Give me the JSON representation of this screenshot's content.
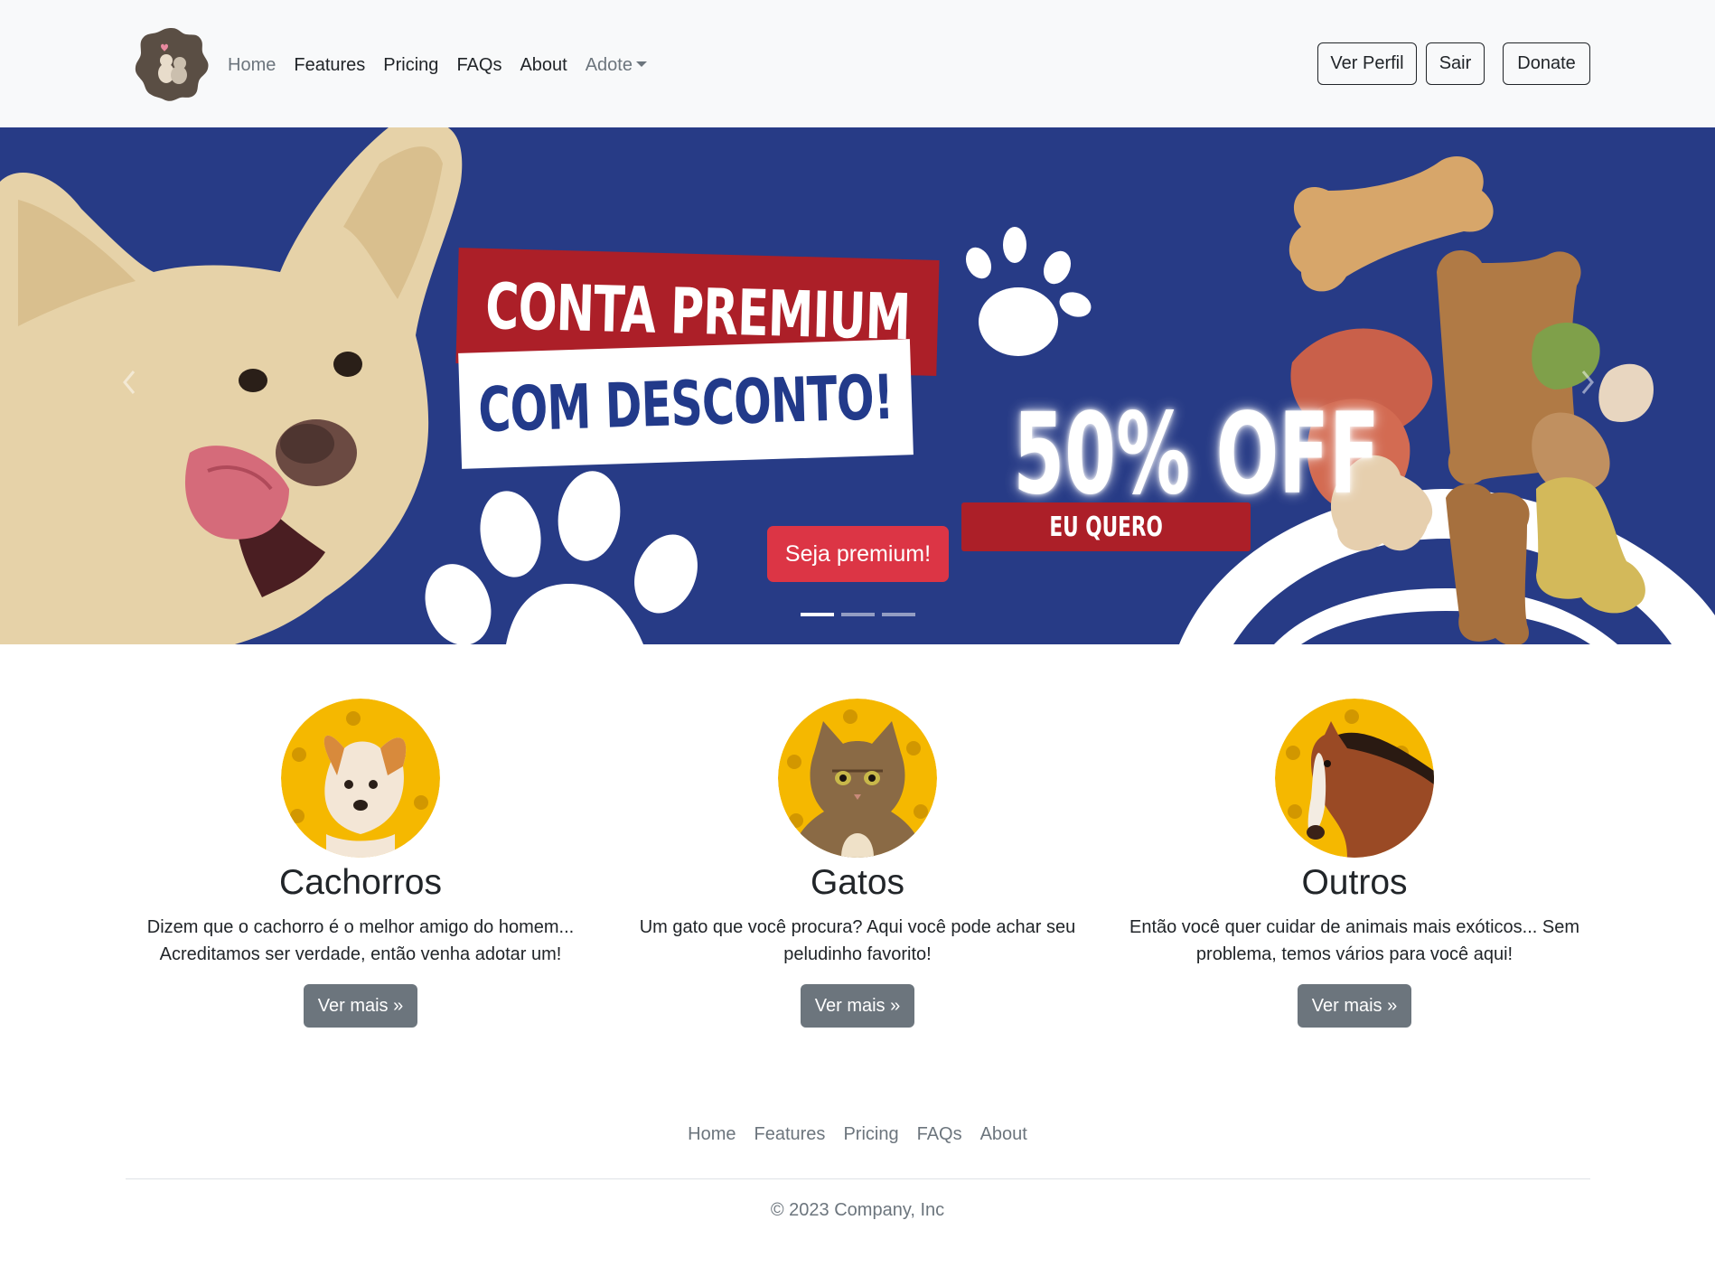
{
  "navbar": {
    "logo_icon": "pet-logo-icon",
    "links": [
      {
        "label": "Home",
        "muted": true
      },
      {
        "label": "Features"
      },
      {
        "label": "Pricing"
      },
      {
        "label": "FAQs"
      },
      {
        "label": "About"
      }
    ],
    "dropdown_label": "Adote",
    "buttons": {
      "profile": "Ver Perfil",
      "logout": "Sair",
      "donate": "Donate"
    }
  },
  "carousel": {
    "banner_line1": "CONTA PREMIUM",
    "banner_line2": "COM DESCONTO!",
    "discount": "50% OFF",
    "discount_cta": "EU QUERO",
    "cta_button": "Seja premium!",
    "slide_count": 3,
    "active_slide": 0,
    "colors": {
      "background": "#273b86",
      "accent_red": "#ac1f28",
      "cta": "#dc3545"
    }
  },
  "features": [
    {
      "icon": "dog-icon",
      "title": "Cachorros",
      "text_line1": "Dizem que o cachorro é o melhor amigo do homem...",
      "text_line2": "Acreditamos ser verdade, então venha adotar um!",
      "button": "Ver mais »"
    },
    {
      "icon": "cat-icon",
      "title": "Gatos",
      "text_line1": "Um gato que você procura? Aqui você pode achar seu",
      "text_line2": "peludinho favorito!",
      "button": "Ver mais »"
    },
    {
      "icon": "horse-icon",
      "title": "Outros",
      "text_line1": "Então você quer cuidar de animais mais exóticos... Sem",
      "text_line2": "problema, temos vários para você aqui!",
      "button": "Ver mais »"
    }
  ],
  "footer": {
    "links": [
      "Home",
      "Features",
      "Pricing",
      "FAQs",
      "About"
    ],
    "copyright": "© 2023 Company, Inc"
  }
}
